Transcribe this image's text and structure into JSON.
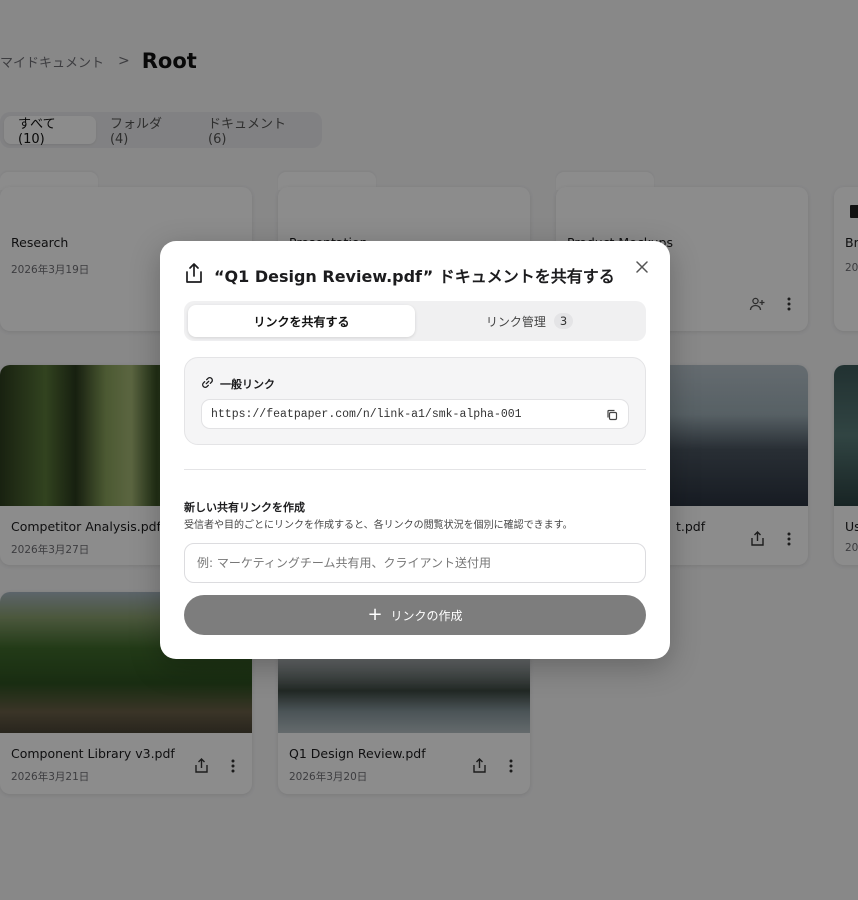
{
  "breadcrumb": {
    "parent": "マイドキュメント",
    "separator": ">",
    "current": "Root"
  },
  "filter_tabs": [
    {
      "label": "すべて(10)",
      "active": true
    },
    {
      "label": "フォルダ(4)",
      "active": false
    },
    {
      "label": "ドキュメント(6)",
      "active": false
    }
  ],
  "cards": {
    "research": {
      "title": "Research",
      "date": "2026年3月19日"
    },
    "presentation": {
      "title": "Presentation"
    },
    "product_mockups": {
      "title": "Product Mockups"
    },
    "br": {
      "title": "Br",
      "date": "20"
    },
    "competitor": {
      "title": "Competitor Analysis.pdf",
      "date": "2026年3月27日"
    },
    "cityscape": {
      "title": "t.pdf"
    },
    "us": {
      "title": "Us",
      "date": "20"
    },
    "component": {
      "title": "Component Library v3.pdf",
      "date": "2026年3月21日"
    },
    "q1": {
      "title": "Q1 Design Review.pdf",
      "date": "2026年3月20日"
    }
  },
  "modal": {
    "title": "“Q1 Design Review.pdf” ドキュメントを共有する",
    "tabs": {
      "share": "リンクを共有する",
      "manage": "リンク管理",
      "manage_count": "3"
    },
    "general_link": {
      "label": "一般リンク",
      "url": "https://featpaper.com/n/link-a1/smk-alpha-001"
    },
    "new_link": {
      "title": "新しい共有リンクを作成",
      "description": "受信者や目的ごとにリンクを作成すると、各リンクの閲覧状況を個別に確認できます。",
      "placeholder": "例: マーケティングチーム共有用、クライアント送付用",
      "value": "",
      "create_button": "リンクの作成"
    }
  },
  "icons": [
    "share-icon",
    "close-icon",
    "link-icon",
    "copy-icon",
    "plus-icon",
    "more-icon",
    "add-user-icon",
    "chevron-right-icon"
  ],
  "colors": {
    "overlay": "#000000",
    "create_button": "#7d7d7d",
    "accent_text": "#1c1c1e"
  }
}
